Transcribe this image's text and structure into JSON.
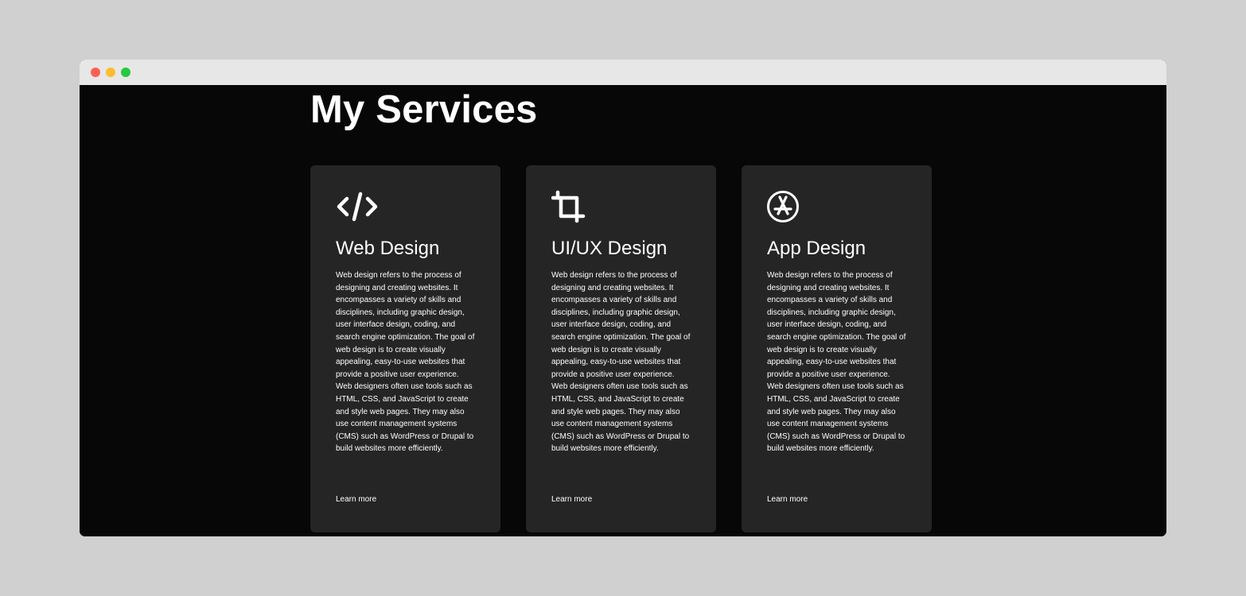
{
  "window": {
    "controls": [
      {
        "name": "close",
        "color": "#fe5f57"
      },
      {
        "name": "minimize",
        "color": "#febc2e"
      },
      {
        "name": "maximize",
        "color": "#28c840"
      }
    ]
  },
  "page": {
    "title": "My Services"
  },
  "services": [
    {
      "icon": "code-icon",
      "title": "Web Design",
      "description": "Web design refers to the process of designing and creating websites. It encompasses a variety of skills and disciplines, including graphic design, user interface design, coding, and search engine optimization. The goal of web design is to create visually appealing, easy-to-use websites that provide a positive user experience. Web designers often use tools such as HTML, CSS, and JavaScript to create and style web pages. They may also use content management systems (CMS) such as WordPress or Drupal to build websites more efficiently.",
      "link": "Learn more"
    },
    {
      "icon": "crop-icon",
      "title": "UI/UX Design",
      "description": "Web design refers to the process of designing and creating websites. It encompasses a variety of skills and disciplines, including graphic design, user interface design, coding, and search engine optimization. The goal of web design is to create visually appealing, easy-to-use websites that provide a positive user experience. Web designers often use tools such as HTML, CSS, and JavaScript to create and style web pages. They may also use content management systems (CMS) such as WordPress or Drupal to build websites more efficiently.",
      "link": "Learn more"
    },
    {
      "icon": "app-store-icon",
      "title": "App Design",
      "description": "Web design refers to the process of designing and creating websites. It encompasses a variety of skills and disciplines, including graphic design, user interface design, coding, and search engine optimization. The goal of web design is to create visually appealing, easy-to-use websites that provide a positive user experience. Web designers often use tools such as HTML, CSS, and JavaScript to create and style web pages. They may also use content management systems (CMS) such as WordPress or Drupal to build websites more efficiently.",
      "link": "Learn more"
    }
  ],
  "colors": {
    "background": "#070707",
    "card": "#252525",
    "text": "#ffffff",
    "titlebar": "#e7e7e7"
  }
}
